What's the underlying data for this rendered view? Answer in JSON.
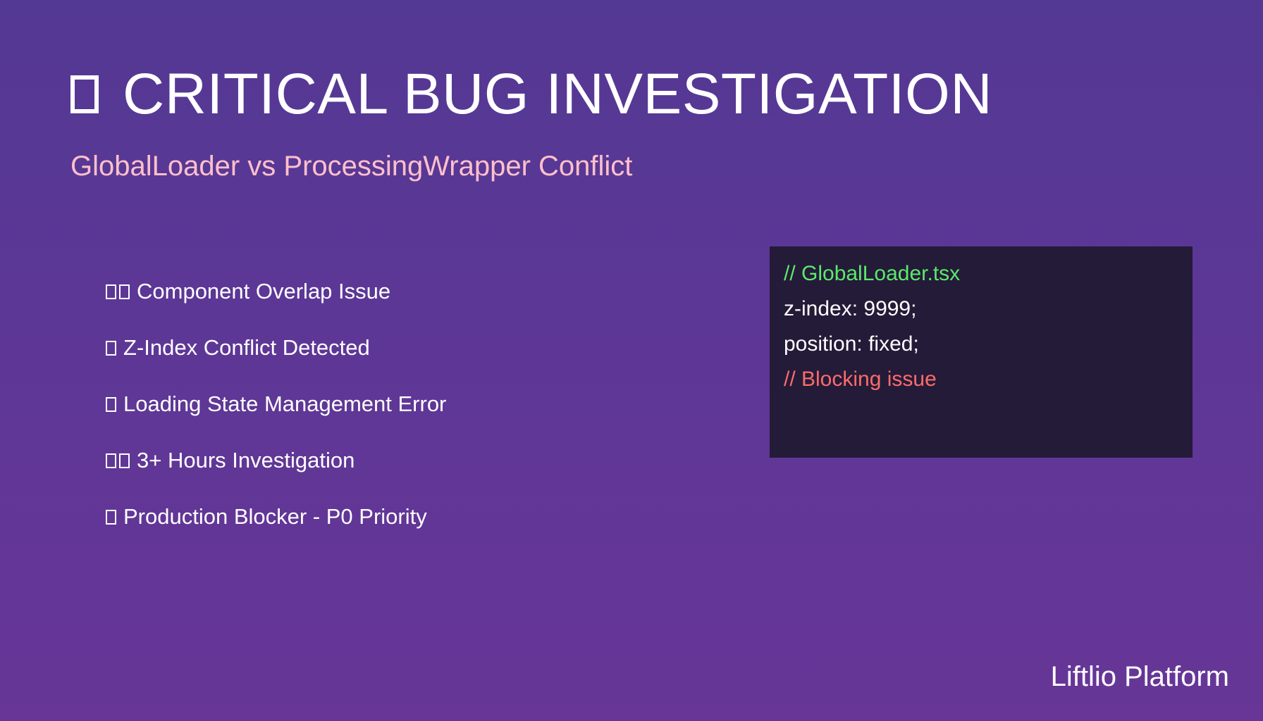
{
  "header": {
    "icon": "warning-glyph-missing",
    "title": "CRITICAL BUG INVESTIGATION",
    "subtitle": "GlobalLoader vs ProcessingWrapper Conflict"
  },
  "bullets": [
    {
      "icon": "double-glyph-icon",
      "text": "Component Overlap Issue",
      "glyph_count": 2
    },
    {
      "icon": "glyph-icon",
      "text": "Z-Index Conflict Detected",
      "glyph_count": 1
    },
    {
      "icon": "glyph-icon",
      "text": "Loading State Management Error",
      "glyph_count": 1
    },
    {
      "icon": "double-glyph-icon",
      "text": "3+ Hours Investigation",
      "glyph_count": 2
    },
    {
      "icon": "glyph-icon",
      "text": "Production Blocker - P0 Priority",
      "glyph_count": 1
    }
  ],
  "code": {
    "lines": [
      {
        "text": "// GlobalLoader.tsx",
        "style": "comment-green"
      },
      {
        "text": "z-index: 9999;",
        "style": "plain"
      },
      {
        "text": "position: fixed;",
        "style": "plain"
      },
      {
        "text": "// Blocking issue",
        "style": "comment-red"
      }
    ]
  },
  "footer": {
    "brand": "Liftlio Platform"
  },
  "colors": {
    "background_top": "#533894",
    "background_bottom": "#673697",
    "subtitle": "#ffc0cb",
    "code_background": "#231b38",
    "comment_green": "#5de86b",
    "comment_red": "#ff6b6b"
  }
}
